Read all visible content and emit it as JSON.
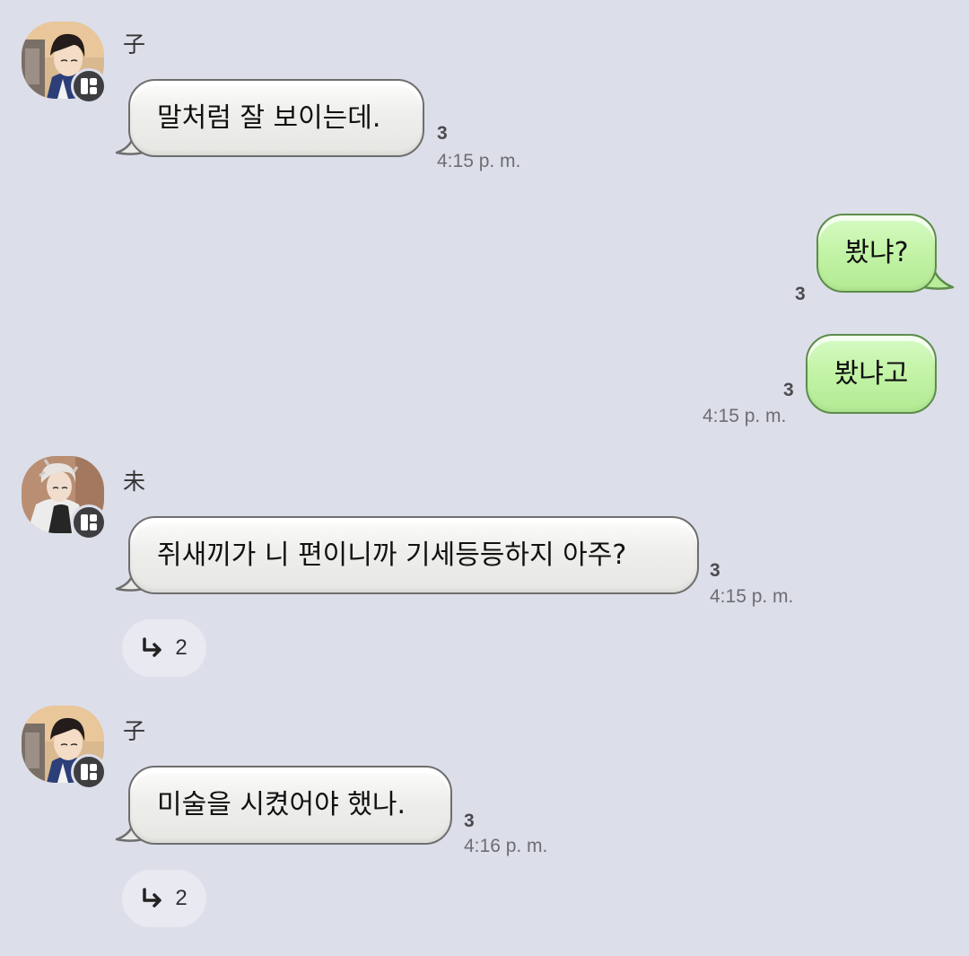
{
  "messages": [
    {
      "sender": "子",
      "text": "말처럼 잘 보이는데.",
      "read": "3",
      "time": "4:15 p. m."
    },
    {
      "text": "봤냐?",
      "read": "3"
    },
    {
      "text": "봤냐고",
      "read": "3",
      "time": "4:15 p. m."
    },
    {
      "sender": "未",
      "text": "쥐새끼가 니 편이니까 기세등등하지 아주?",
      "read": "3",
      "time": "4:15 p. m.",
      "replies": "2"
    },
    {
      "sender": "子",
      "text": "미술을 시켰어야 했나.",
      "read": "3",
      "time": "4:16 p. m.",
      "replies": "2"
    }
  ],
  "icons": {
    "avatar_badge": "app-grid-icon",
    "reply": "reply-arrow-icon"
  },
  "colors": {
    "background": "#dcdeea",
    "incoming_bubble": "#eeeeec",
    "outgoing_bubble": "#c4f4a8",
    "outgoing_border": "#5d8c4b"
  }
}
